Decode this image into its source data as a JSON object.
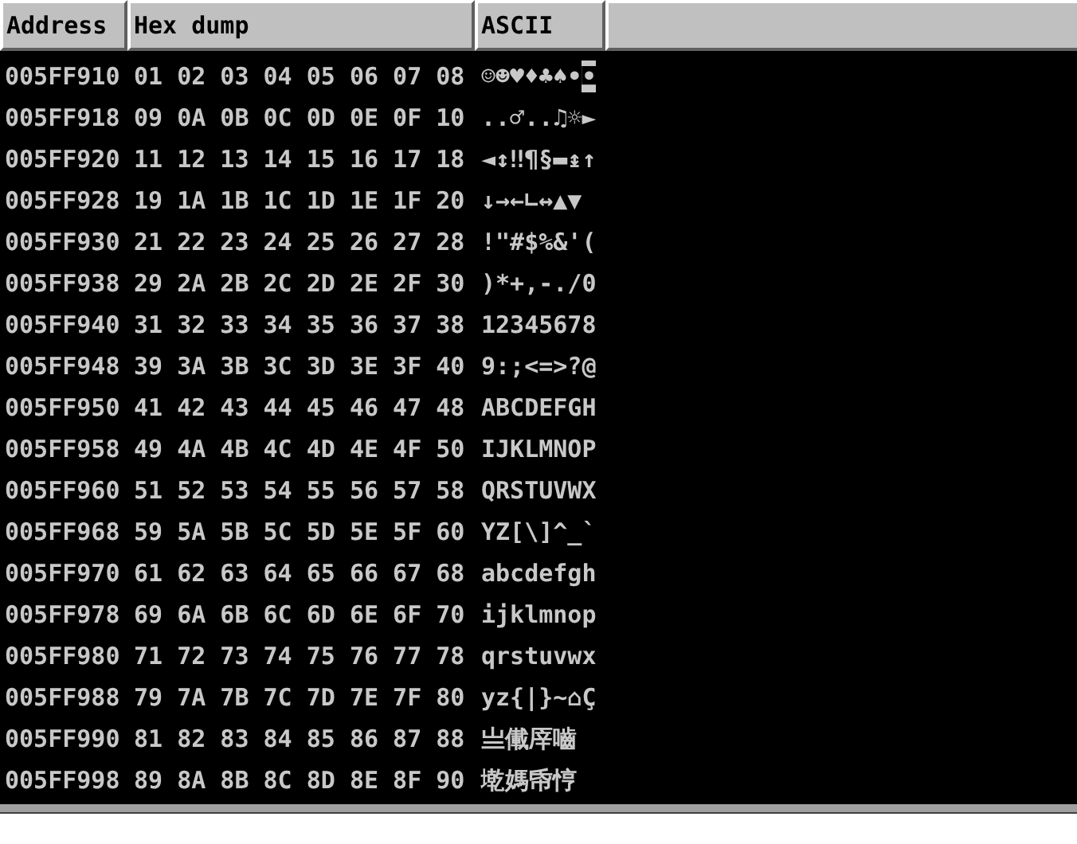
{
  "columns": [
    "Address",
    "Hex dump",
    "ASCII"
  ],
  "rows": [
    {
      "address": "005FF910",
      "hex": "01 02 03 04 05 06 07 08",
      "ascii": "☺☻♥♦♣♠•",
      "ascii_highlight": "◘"
    },
    {
      "address": "005FF918",
      "hex": "09 0A 0B 0C 0D 0E 0F 10",
      "ascii": "..♂..♫☼►"
    },
    {
      "address": "005FF920",
      "hex": "11 12 13 14 15 16 17 18",
      "ascii": "◄↕‼¶§▬↨↑"
    },
    {
      "address": "005FF928",
      "hex": "19 1A 1B 1C 1D 1E 1F 20",
      "ascii": "↓→←∟↔▲▼"
    },
    {
      "address": "005FF930",
      "hex": "21 22 23 24 25 26 27 28",
      "ascii": "!\"#$%&'("
    },
    {
      "address": "005FF938",
      "hex": "29 2A 2B 2C 2D 2E 2F 30",
      "ascii": ")*+,-./0"
    },
    {
      "address": "005FF940",
      "hex": "31 32 33 34 35 36 37 38",
      "ascii": "12345678"
    },
    {
      "address": "005FF948",
      "hex": "39 3A 3B 3C 3D 3E 3F 40",
      "ascii": "9:;<=>?@"
    },
    {
      "address": "005FF950",
      "hex": "41 42 43 44 45 46 47 48",
      "ascii": "ABCDEFGH"
    },
    {
      "address": "005FF958",
      "hex": "49 4A 4B 4C 4D 4E 4F 50",
      "ascii": "IJKLMNOP"
    },
    {
      "address": "005FF960",
      "hex": "51 52 53 54 55 56 57 58",
      "ascii": "QRSTUVWX"
    },
    {
      "address": "005FF968",
      "hex": "59 5A 5B 5C 5D 5E 5F 60",
      "ascii": "YZ[\\]^_`"
    },
    {
      "address": "005FF970",
      "hex": "61 62 63 64 65 66 67 68",
      "ascii": "abcdefgh"
    },
    {
      "address": "005FF978",
      "hex": "69 6A 6B 6C 6D 6E 6F 70",
      "ascii": "ijklmnop"
    },
    {
      "address": "005FF980",
      "hex": "71 72 73 74 75 76 77 78",
      "ascii": "qrstuvwx"
    },
    {
      "address": "005FF988",
      "hex": "79 7A 7B 7C 7D 7E 7F 80",
      "ascii": "yz{|}~⌂Ç"
    },
    {
      "address": "005FF990",
      "hex": "81 82 83 84 85 86 87 88",
      "ascii": "亗儎厗嚙"
    },
    {
      "address": "005FF998",
      "hex": "89 8A 8B 8C 8D 8E 8F 90",
      "ascii": "墘媽帋悙"
    }
  ]
}
